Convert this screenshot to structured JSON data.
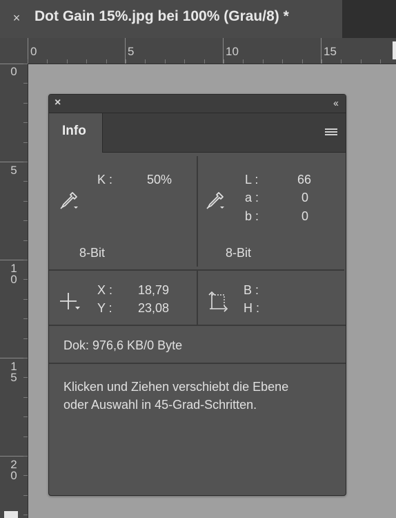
{
  "document_tab": {
    "close_glyph": "×",
    "title": "Dot Gain 15%.jpg bei 100% (Grau/8) *"
  },
  "rulers": {
    "horizontal_labels": [
      "0",
      "5",
      "10",
      "15"
    ],
    "vertical_labels": [
      "0",
      "5",
      "10",
      "15",
      "20"
    ]
  },
  "panel": {
    "close_glyph": "×",
    "collapse_glyph": "‹‹",
    "tab_label": "Info",
    "left_top": {
      "channel_label": "K :",
      "channel_value": "50%",
      "bit_depth": "8-Bit"
    },
    "right_top": {
      "rows": [
        {
          "label": "L :",
          "value": "66"
        },
        {
          "label": "a :",
          "value": "0"
        },
        {
          "label": "b :",
          "value": "0"
        }
      ],
      "bit_depth": "8-Bit"
    },
    "coords": {
      "x_label": "X :",
      "x_value": "18,79",
      "y_label": "Y :",
      "y_value": "23,08"
    },
    "size": {
      "w_label": "B :",
      "h_label": "H :"
    },
    "status": "Dok: 976,6 KB/0 Byte",
    "hint": "Klicken und Ziehen verschiebt die Ebene oder Auswahl in 45-Grad-Schritten."
  },
  "colors": {
    "panel_bg": "#535353",
    "header_bg": "#3d3d3d",
    "canvas_bg": "#9f9f9f",
    "tabbar_bg": "#2f2f2f"
  },
  "icons": [
    "close-icon",
    "collapse-icon",
    "panel-menu-icon",
    "eyedropper-icon",
    "crosshair-icon",
    "selection-size-icon"
  ]
}
